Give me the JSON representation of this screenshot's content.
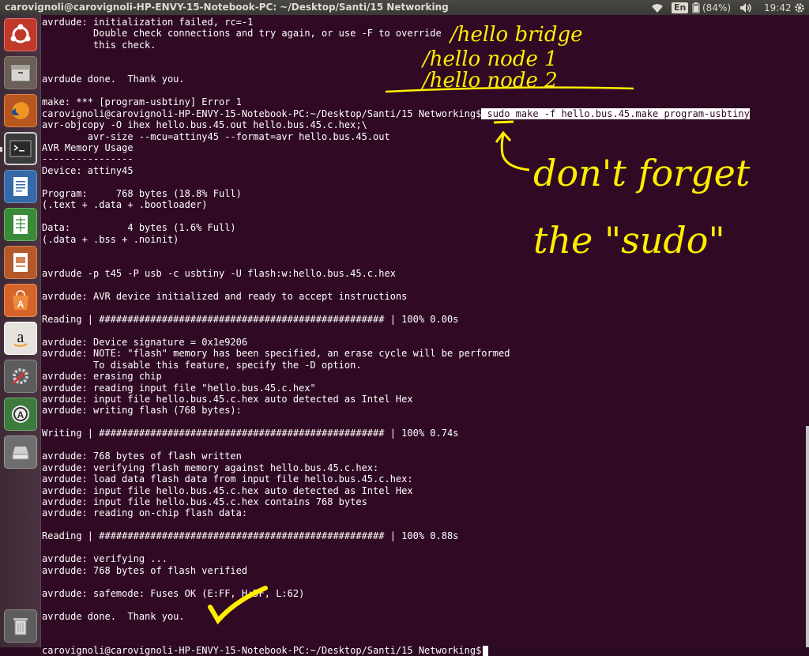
{
  "window": {
    "title": "carovignoli@carovignoli-HP-ENVY-15-Notebook-PC: ~/Desktop/Santi/15 Networking"
  },
  "indicators": {
    "wifi_icon": "wifi-icon",
    "keyboard_lang": "En",
    "battery": "(84%)",
    "sound_icon": "volume-icon",
    "time": "19:42",
    "power_icon": "gear-icon"
  },
  "launcher": {
    "items": [
      {
        "name": "ubuntu-dash-icon"
      },
      {
        "name": "files-icon"
      },
      {
        "name": "firefox-icon"
      },
      {
        "name": "terminal-icon"
      },
      {
        "name": "writer-icon"
      },
      {
        "name": "calc-icon"
      },
      {
        "name": "impress-icon"
      },
      {
        "name": "software-center-icon"
      },
      {
        "name": "amazon-icon"
      },
      {
        "name": "system-settings-icon"
      },
      {
        "name": "software-updater-icon"
      },
      {
        "name": "disk-drive-icon"
      },
      {
        "name": "trash-icon"
      }
    ]
  },
  "terminal": {
    "lines": [
      "avrdude: initialization failed, rc=-1",
      "         Double check connections and try again, or use -F to override",
      "         this check.",
      "",
      "",
      "avrdude done.  Thank you.",
      "",
      "make: *** [program-usbtiny] Error 1",
      "",
      "avr-objcopy -O ihex hello.bus.45.out hello.bus.45.c.hex;\\",
      "        avr-size --mcu=attiny45 --format=avr hello.bus.45.out",
      "AVR Memory Usage",
      "----------------",
      "Device: attiny45",
      "",
      "Program:     768 bytes (18.8% Full)",
      "(.text + .data + .bootloader)",
      "",
      "Data:          4 bytes (1.6% Full)",
      "(.data + .bss + .noinit)",
      "",
      "",
      "avrdude -p t45 -P usb -c usbtiny -U flash:w:hello.bus.45.c.hex",
      "",
      "avrdude: AVR device initialized and ready to accept instructions",
      "",
      "Reading | ################################################## | 100% 0.00s",
      "",
      "avrdude: Device signature = 0x1e9206",
      "avrdude: NOTE: \"flash\" memory has been specified, an erase cycle will be performed",
      "         To disable this feature, specify the -D option.",
      "avrdude: erasing chip",
      "avrdude: reading input file \"hello.bus.45.c.hex\"",
      "avrdude: input file hello.bus.45.c.hex auto detected as Intel Hex",
      "avrdude: writing flash (768 bytes):",
      "",
      "Writing | ################################################## | 100% 0.74s",
      "",
      "avrdude: 768 bytes of flash written",
      "avrdude: verifying flash memory against hello.bus.45.c.hex:",
      "avrdude: load data flash data from input file hello.bus.45.c.hex:",
      "avrdude: input file hello.bus.45.c.hex auto detected as Intel Hex",
      "avrdude: input file hello.bus.45.c.hex contains 768 bytes",
      "avrdude: reading on-chip flash data:",
      "",
      "Reading | ################################################## | 100% 0.88s",
      "",
      "avrdude: verifying ...",
      "avrdude: 768 bytes of flash verified",
      "",
      "avrdude: safemode: Fuses OK (E:FF, H:DF, L:62)",
      "",
      "avrdude done.  Thank you.",
      "",
      ""
    ],
    "prompt_line_1": {
      "prompt": "carovignoli@carovignoli-HP-ENVY-15-Notebook-PC:~/Desktop/Santi/15 Networking$",
      "command": " sudo make -f hello.bus.45.make program-usbtiny"
    },
    "prompt_line_2": {
      "prompt": "carovignoli@carovignoli-HP-ENVY-15-Notebook-PC:~/Desktop/Santi/15 Networking$"
    }
  },
  "annotations": {
    "color": "#ffee00",
    "note_1": "/hello bridge",
    "note_2": "/hello node 1",
    "note_3": "/hello node 2",
    "note_4": "don't forget",
    "note_5": "the \"sudo\""
  }
}
